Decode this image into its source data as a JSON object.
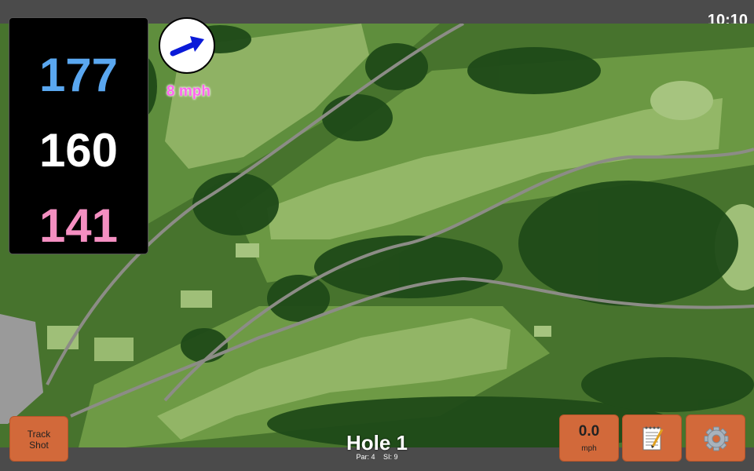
{
  "status": {
    "time": "10:10"
  },
  "distances": {
    "back": "177",
    "middle": "160",
    "front": "141"
  },
  "wind": {
    "speed": "8 mph",
    "icon": "arrow-right-icon"
  },
  "buttons": {
    "track_shot": "Track\nShot",
    "speed_value": "0.0",
    "speed_unit": "mph",
    "notes_icon": "notepad-icon",
    "settings_icon": "gear-icon"
  },
  "hole": {
    "title": "Hole 1",
    "par": "Par: 4",
    "si": "SI: 9"
  },
  "colors": {
    "back": "#5aa7f0",
    "middle": "#ffffff",
    "front": "#f48fc1",
    "wind_text": "#ff66ee",
    "button": "#d2693a"
  }
}
